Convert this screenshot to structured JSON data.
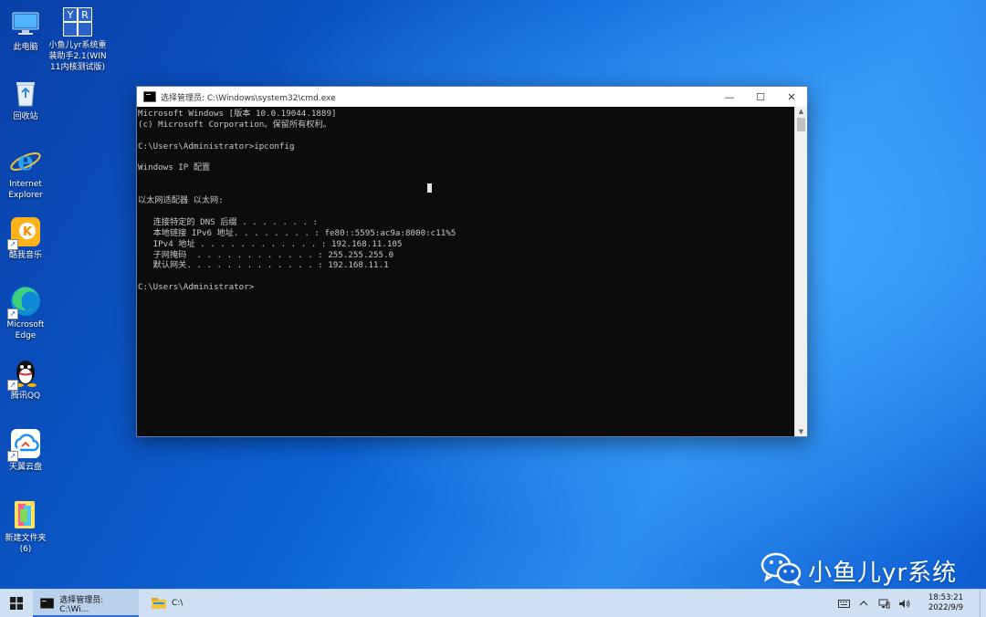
{
  "desktop": {
    "icons": [
      {
        "label": "此电脑",
        "icon": "computer-icon"
      },
      {
        "label": "小鱼儿yr系统重装助手2.1(WIN11内核测试版)",
        "icon": "yr-logo-icon",
        "logo_text": "YR系统"
      },
      {
        "label": "回收站",
        "icon": "recycle-bin-icon"
      },
      {
        "label": "Internet Explorer",
        "icon": "ie-icon"
      },
      {
        "label": "酷我音乐",
        "icon": "kuwo-music-icon"
      },
      {
        "label": "Microsoft Edge",
        "icon": "edge-icon"
      },
      {
        "label": "腾讯QQ",
        "icon": "qq-icon"
      },
      {
        "label": "天翼云盘",
        "icon": "tianyi-cloud-icon"
      },
      {
        "label": "新建文件夹 (6)",
        "icon": "folder-icon"
      }
    ]
  },
  "cmd": {
    "title": "选择管理员: C:\\Windows\\system32\\cmd.exe",
    "lines": [
      "Microsoft Windows [版本 10.0.19044.1889]",
      "(c) Microsoft Corporation。保留所有权利。",
      "",
      "C:\\Users\\Administrator>ipconfig",
      "",
      "Windows IP 配置",
      "",
      "",
      "以太网适配器 以太网:",
      "",
      "   连接特定的 DNS 后缀 . . . . . . . :",
      "   本地链接 IPv6 地址. . . . . . . . : fe80::5595:ac9a:8000:c11%5",
      "   IPv4 地址 . . . . . . . . . . . . : 192.168.11.105",
      "   子网掩码  . . . . . . . . . . . . : 255.255.255.0",
      "   默认网关. . . . . . . . . . . . . : 192.168.11.1",
      "",
      "C:\\Users\\Administrator>"
    ],
    "buttons": {
      "minimize": "—",
      "maximize": "☐",
      "close": "✕"
    }
  },
  "watermark": {
    "text": "小鱼儿yr系统",
    "icon": "wechat-icon"
  },
  "taskbar": {
    "items": [
      {
        "label": "选择管理员: C:\\Wi...",
        "icon": "cmd-icon",
        "active": true
      },
      {
        "label": "C:\\",
        "icon": "explorer-folder-icon",
        "active": false
      }
    ],
    "tray": {
      "keyboard_icon": "keyboard-icon",
      "chevron_icon": "chevron-up-icon",
      "network_icon": "network-icon",
      "volume_icon": "volume-icon",
      "time": "18:53:21",
      "date": "2022/9/9"
    }
  }
}
